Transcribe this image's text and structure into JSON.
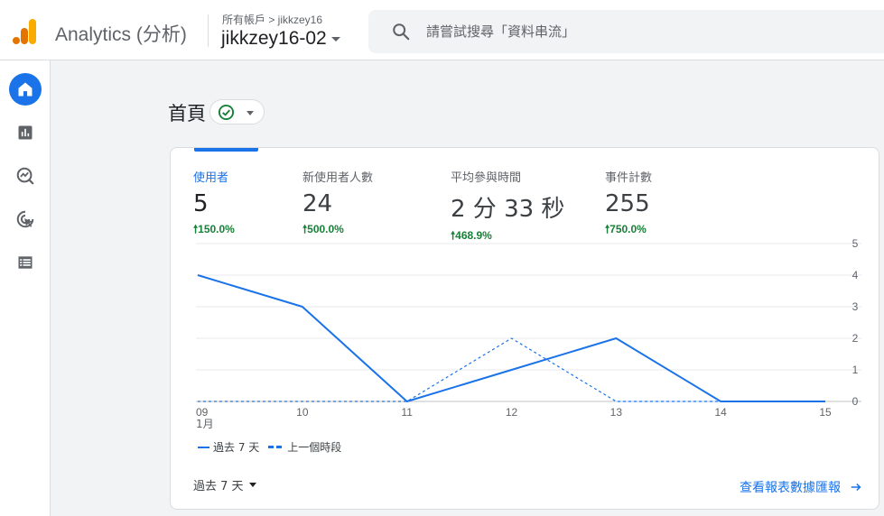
{
  "header": {
    "app_name": "Analytics (分析)",
    "breadcrumb": "所有帳戶 > jikkzey16",
    "account_name": "jikkzey16-02",
    "search_placeholder": "請嘗試搜尋「資料串流」"
  },
  "brand_colors": {
    "primary": "#1a73e8",
    "logo_dark": "#e37400",
    "logo_light": "#f9ab00",
    "positive": "#188038"
  },
  "rail": {
    "items": [
      {
        "name": "home",
        "icon": "home-icon",
        "active": true
      },
      {
        "name": "reports",
        "icon": "bar-chart-icon",
        "active": false
      },
      {
        "name": "explore",
        "icon": "explore-icon",
        "active": false
      },
      {
        "name": "advertising",
        "icon": "advertising-icon",
        "active": false
      },
      {
        "name": "configure",
        "icon": "list-icon",
        "active": false
      }
    ]
  },
  "page": {
    "title": "首頁"
  },
  "metrics": [
    {
      "label": "使用者",
      "value": "5",
      "change": "150.0%"
    },
    {
      "label": "新使用者人數",
      "value": "24",
      "change": "500.0%"
    },
    {
      "label": "平均參與時間",
      "value": "2 分 33 秒",
      "change": "468.9%"
    },
    {
      "label": "事件計數",
      "value": "255",
      "change": "750.0%"
    }
  ],
  "chart_data": {
    "type": "line",
    "categories": [
      "09",
      "10",
      "11",
      "12",
      "13",
      "14",
      "15"
    ],
    "x_month_label": "1月",
    "y_ticks": [
      "5",
      "4",
      "3",
      "2",
      "1",
      "0"
    ],
    "ylim": [
      0,
      5
    ],
    "grid": true,
    "series": [
      {
        "name": "過去 7 天",
        "style": "solid",
        "values": [
          4,
          3,
          0,
          1,
          2,
          0,
          0
        ]
      },
      {
        "name": "上一個時段",
        "style": "dashed",
        "values": [
          0,
          0,
          0,
          2,
          0,
          0,
          0
        ]
      }
    ]
  },
  "footer": {
    "date_range": "過去 7 天",
    "report_link": "查看報表數據匯報"
  }
}
